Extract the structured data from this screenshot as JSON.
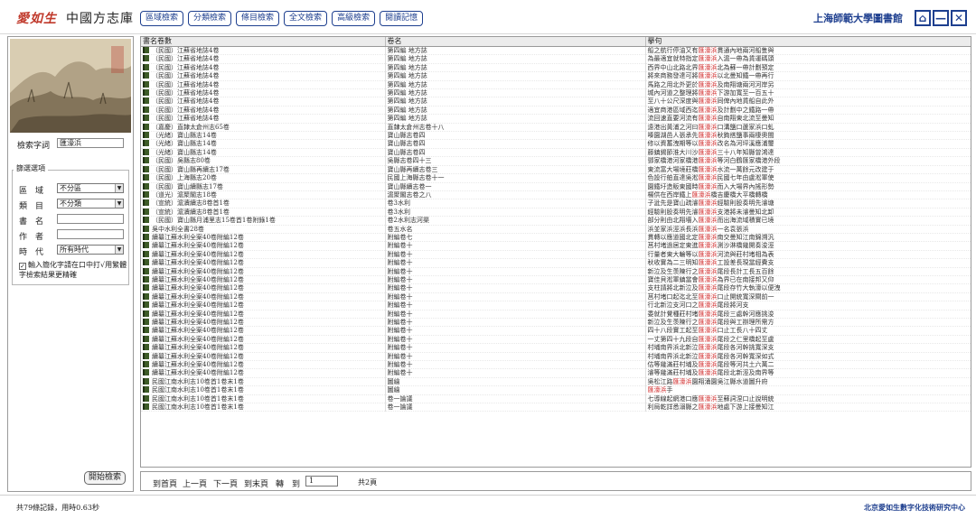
{
  "app": {
    "logo_mark": "愛如生",
    "title": "中國方志庫",
    "library": "上海師範大學圖書館",
    "menu": [
      "區域檢索",
      "分類檢索",
      "條目檢索",
      "全文檢索",
      "高級檢索",
      "閱讀記憶"
    ],
    "window_controls": [
      "⌂",
      "—",
      "✕"
    ]
  },
  "sidebar": {
    "search_label": "檢索字詞",
    "search_value": "匯濠浜",
    "filter_title": "篩選選項",
    "filters": [
      {
        "label": "區　域",
        "value": "不分區",
        "type": "select"
      },
      {
        "label": "類　目",
        "value": "不分類",
        "type": "select"
      },
      {
        "label": "書　名",
        "value": "",
        "type": "text"
      },
      {
        "label": "作　者",
        "value": "",
        "type": "text"
      },
      {
        "label": "時　代",
        "value": "所有時代",
        "type": "select"
      }
    ],
    "tip_check": "✓",
    "tip": "輸入簡化字請在口中打√用繁體字檢索結果更精確",
    "search_button": "開始檢索"
  },
  "table": {
    "columns": [
      "書名卷數",
      "卷名",
      "擧句"
    ],
    "rows": [
      [
        "（民國）江蘇省地誌4卷",
        "第四編 地方誌",
        "船之航行停油又有",
        "匯濠浜",
        "貫通內地兩河船隻與"
      ],
      [
        "（民國）江蘇省地誌4卷",
        "第四編 地方誌",
        "為最適宜就特指定",
        "匯濠浜",
        "入滬一帶為貨運碼頭"
      ],
      [
        "（民國）江蘇省地誌4卷",
        "第四編 地方誌",
        "西界中山北路北界",
        "匯濠浜",
        "北為蘇一帶計劃預定"
      ],
      [
        "（民國）江蘇省地誌4卷",
        "第四編 地方誌",
        "將來商務發達可將",
        "匯濠浜",
        "以北曼知鐵一帶再行"
      ],
      [
        "（民國）江蘇省地誌4卷",
        "第四編 地方誌",
        "馬路之用北外更於",
        "匯濠浜",
        "及南翔塘兩河河岸另"
      ],
      [
        "（民國）江蘇省地誌4卷",
        "第四編 地方誌",
        "城內河道之整理將",
        "匯濠浜",
        "下游加寬至一百五十"
      ],
      [
        "（民國）江蘇省地誌4卷",
        "第四編 地方誌",
        "至八十公尺深度與",
        "匯濠浜",
        "同俾內地貨船自此外"
      ],
      [
        "（民國）江蘇省地誌4卷",
        "第四編 地方誌",
        "適宜商港區域西迄",
        "匯濠浜",
        "及計劃中之鐵路一帶"
      ],
      [
        "（民國）江蘇省地誌4卷",
        "第四編 地方誌",
        "流回速直要河流有",
        "匯濠浜",
        "自南翔東北流至曼知"
      ],
      [
        "（嘉慶）直隸太倉州志65卷",
        "直隸太倉州志卷十八",
        "遠港出黃浦之河曰",
        "匯濠浜",
        "口溝鹽口蘆家浜口虬"
      ],
      [
        "（光緒）寶山縣志14卷",
        "寶山縣志卷四",
        "嗪園湖邑人張承先",
        "匯濠浜",
        "秋鉤搭鹽事兩棲奧閩"
      ],
      [
        "（光緒）寶山縣志14卷",
        "寶山縣志卷四",
        "修以資蓄洩期等以",
        "匯濠浜",
        "改名為河坪溪應浦璽"
      ],
      [
        "（光緒）寶山縣志14卷",
        "寶山縣志卷四",
        "藤鎮錫節淮大川沙",
        "匯濠浜",
        "三十八年知縣曾鴻達"
      ],
      [
        "（民國）吳縣志80卷",
        "吳縣志卷四十三",
        "鄧家橋港河家橋港",
        "匯濠浜",
        "等河白鶴匯家橋港外段"
      ],
      [
        "（民國）寶山縣再續志17卷",
        "寶山縣再續志卷三",
        "東流富大場境莊橋",
        "匯濠浜",
        "水流一萬餘元改建于"
      ],
      [
        "（民國）上海縣志20卷",
        "民國上海縣志卷十一",
        "色設行舶直達吳淞",
        "匯濠浜",
        "民國七年由盧淞軍使"
      ],
      [
        "（民國）寶山續縣志17卷",
        "寶山縣續志卷一",
        "園鐵圩造販東國時",
        "匯濠浜",
        "而入大場界內搖形勢"
      ],
      [
        "（道光）滬聚閣志18卷",
        "滬聚閣志卷之八",
        "楊供在西岸鐵上",
        "匯濠浜",
        "橋吉慶橋大平橋轉橋"
      ],
      [
        "（宣統）滬瀆續志8卷首1卷",
        "卷3水利",
        "子泚先是寶山疏濬",
        "匯濠浜",
        "經驗則股奏明先濬塘"
      ],
      [
        "（宣統）滬瀆續志8卷首1卷",
        "卷3水利",
        "經驗則股奏明先濬",
        "匯濠浜",
        "支港將未濬曼知北卸"
      ],
      [
        "（民國）寶山縣月浦里志15卷首1卷附錄1卷",
        "卷2水利志河渠",
        "部分則由北翔墻入",
        "匯濠浜",
        "而出海流域積實已境"
      ],
      [
        "吳中水利全書28卷",
        "卷五水名",
        "浜並家浜涇浜長浜",
        "匯濠浜",
        "一名袁張浜"
      ],
      [
        "續纂江蘇水利全案40卷附編12卷",
        "附編卷七",
        "貫轉以應道國北定",
        "匯濠浜",
        "南交曼知江南錦溯汎"
      ],
      [
        "續纂江蘇水利全案40卷附編12卷",
        "附編卷十",
        "莒村堵過居定東進",
        "匯濠浜",
        "測沙淋橋幾開奏浚涇"
      ],
      [
        "續纂江蘇水利全案40卷附編12卷",
        "附編卷十",
        "行量者東大輪等以",
        "匯濠浜",
        "河流與莊村堵相為表"
      ],
      [
        "續纂江蘇水利全案40卷附編12卷",
        "附編卷十",
        "秋收實為二三明知",
        "匯濠浜",
        "工設差長現當經費支"
      ],
      [
        "續纂江蘇水利全案40卷附編12卷",
        "附編卷十",
        "新泣及生羡陳行之",
        "匯濠浜",
        "尾段長計工長五百餘"
      ],
      [
        "續纂江蘇水利全案40卷附編12卷",
        "附編卷十",
        "寶佳貝淞軍鎮當會",
        "匯濠浜",
        "為界已在南接邦又仰"
      ],
      [
        "續纂江蘇水利全案40卷附編12卷",
        "附編卷十",
        "支柱請將北新泣及",
        "匯濠浜",
        "尾段存竹大執濠以便洩"
      ],
      [
        "續纂江蘇水利全案40卷附編12卷",
        "附編卷十",
        "莒村堵口起迄北至",
        "匯濠浜",
        "口止開統寬深閘前一"
      ],
      [
        "續纂江蘇水利全案40卷附編12卷",
        "附編卷十",
        "行北新泣支河口之",
        "匯濠浜",
        "尾段將河支"
      ],
      [
        "續纂江蘇水利全案40卷附編12卷",
        "附編卷十",
        "委就計覺種莊村堵",
        "匯濠浜",
        "尾段三處幹河應挑浚"
      ],
      [
        "續纂江蘇水利全案40卷附編12卷",
        "附編卷十",
        "新泣及生羡陳行之",
        "匯濠浜",
        "尾段與工辦理所需方"
      ],
      [
        "續纂江蘇水利全案40卷附編12卷",
        "附編卷十",
        "四十八段實工起至",
        "匯濠浜",
        "口止工長八十四丈"
      ],
      [
        "續纂江蘇水利全案40卷附編12卷",
        "附編卷十",
        "一丈第四十九段自",
        "匯濠浜",
        "尾段之仁里橋起至盧"
      ],
      [
        "續纂江蘇水利全案40卷附編12卷",
        "附編卷十",
        "村埔南界浜北新泣",
        "匯濠浜",
        "尾段各河幹挑寬深支"
      ],
      [
        "續纂江蘇水利全案40卷附編12卷",
        "附編卷十",
        "村埔南界浜北新泣",
        "匯濠浜",
        "尾段各河幹寬深如式"
      ],
      [
        "續纂江蘇水利全案40卷附編12卷",
        "附編卷十",
        "估等幾滿莊村埔及",
        "匯濠浜",
        "尾段等河共土六萬二"
      ],
      [
        "續纂江蘇水利全案40卷附編12卷",
        "附編卷十",
        "濬等幾滿莊村埔及",
        "匯濠浜",
        "尾段北新涇及南界等"
      ],
      [
        "民國江南水利志10卷首1卷末1卷",
        "圖繪",
        "吳松江路",
        "匯濠浜",
        "園翔涌園吳江縣水道圖升府"
      ],
      [
        "民國江南水利志10卷首1卷末1卷",
        "圖繪",
        "",
        "匯濠浜",
        "手"
      ],
      [
        "民國江南水利志10卷首1卷末1卷",
        "卷一論議",
        "七導線起網港口應",
        "匯濠浜",
        "至蘇詞涅口止說明統"
      ],
      [
        "民國江南水利志10卷首1卷末1卷",
        "卷一論議",
        "利局乾詳悉溺縣之",
        "匯濠浜",
        "地處下游上接曼知江"
      ]
    ]
  },
  "pager": {
    "first": "到首頁",
    "prev": "上一頁",
    "next": "下一頁",
    "last": "到末頁",
    "goto": "轉",
    "to": "到",
    "page_value": "1",
    "total": "共2頁"
  },
  "status": {
    "left": "共79條記錄，用時0.63秒",
    "right": "北京愛如生數字化技術研究中心"
  },
  "colors": {
    "accent": "#1e3f8f",
    "highlight": "#d12b2b",
    "logo": "#c0392b"
  }
}
